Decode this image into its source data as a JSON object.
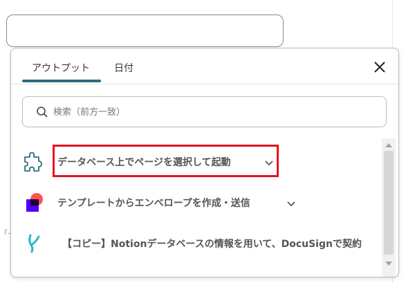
{
  "background": {
    "edge_text": "「+"
  },
  "popup": {
    "tabs": [
      {
        "label": "アウトプット",
        "active": true
      },
      {
        "label": "日付",
        "active": false
      }
    ],
    "close_icon": "close-icon",
    "search": {
      "placeholder": "検索（前方一致）",
      "value": "",
      "icon": "search-icon"
    },
    "items": [
      {
        "label": "データベース上でページを選択して起動",
        "icon": "puzzle-icon",
        "expandable": true,
        "highlighted": true
      },
      {
        "label": "テンプレートからエンベロープを作成・送信",
        "icon": "docusign-icon",
        "expandable": true,
        "highlighted": false
      },
      {
        "label": "【コピー】Notionデータベースの情報を用いて、DocuSignで契約",
        "icon": "yoom-icon",
        "expandable": false,
        "highlighted": false
      }
    ]
  },
  "colors": {
    "accent": "#2d6e7e",
    "highlight": "#e0151f",
    "docusign_red": "#ff5252",
    "docusign_purple": "#4c00ff",
    "yoom_teal": "#2bb5c8"
  }
}
